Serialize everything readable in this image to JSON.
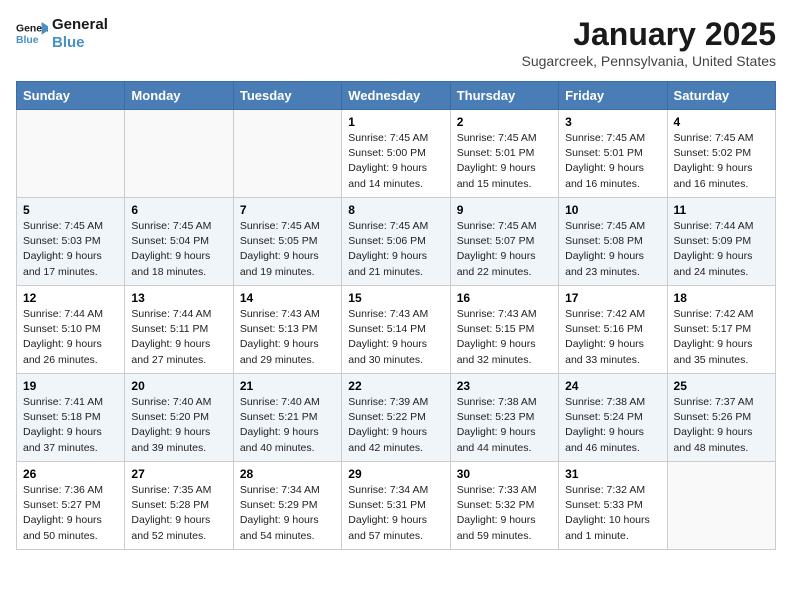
{
  "header": {
    "logo_line1": "General",
    "logo_line2": "Blue",
    "month_title": "January 2025",
    "subtitle": "Sugarcreek, Pennsylvania, United States"
  },
  "weekdays": [
    "Sunday",
    "Monday",
    "Tuesday",
    "Wednesday",
    "Thursday",
    "Friday",
    "Saturday"
  ],
  "weeks": [
    [
      {
        "day": "",
        "info": ""
      },
      {
        "day": "",
        "info": ""
      },
      {
        "day": "",
        "info": ""
      },
      {
        "day": "1",
        "info": "Sunrise: 7:45 AM\nSunset: 5:00 PM\nDaylight: 9 hours\nand 14 minutes."
      },
      {
        "day": "2",
        "info": "Sunrise: 7:45 AM\nSunset: 5:01 PM\nDaylight: 9 hours\nand 15 minutes."
      },
      {
        "day": "3",
        "info": "Sunrise: 7:45 AM\nSunset: 5:01 PM\nDaylight: 9 hours\nand 16 minutes."
      },
      {
        "day": "4",
        "info": "Sunrise: 7:45 AM\nSunset: 5:02 PM\nDaylight: 9 hours\nand 16 minutes."
      }
    ],
    [
      {
        "day": "5",
        "info": "Sunrise: 7:45 AM\nSunset: 5:03 PM\nDaylight: 9 hours\nand 17 minutes."
      },
      {
        "day": "6",
        "info": "Sunrise: 7:45 AM\nSunset: 5:04 PM\nDaylight: 9 hours\nand 18 minutes."
      },
      {
        "day": "7",
        "info": "Sunrise: 7:45 AM\nSunset: 5:05 PM\nDaylight: 9 hours\nand 19 minutes."
      },
      {
        "day": "8",
        "info": "Sunrise: 7:45 AM\nSunset: 5:06 PM\nDaylight: 9 hours\nand 21 minutes."
      },
      {
        "day": "9",
        "info": "Sunrise: 7:45 AM\nSunset: 5:07 PM\nDaylight: 9 hours\nand 22 minutes."
      },
      {
        "day": "10",
        "info": "Sunrise: 7:45 AM\nSunset: 5:08 PM\nDaylight: 9 hours\nand 23 minutes."
      },
      {
        "day": "11",
        "info": "Sunrise: 7:44 AM\nSunset: 5:09 PM\nDaylight: 9 hours\nand 24 minutes."
      }
    ],
    [
      {
        "day": "12",
        "info": "Sunrise: 7:44 AM\nSunset: 5:10 PM\nDaylight: 9 hours\nand 26 minutes."
      },
      {
        "day": "13",
        "info": "Sunrise: 7:44 AM\nSunset: 5:11 PM\nDaylight: 9 hours\nand 27 minutes."
      },
      {
        "day": "14",
        "info": "Sunrise: 7:43 AM\nSunset: 5:13 PM\nDaylight: 9 hours\nand 29 minutes."
      },
      {
        "day": "15",
        "info": "Sunrise: 7:43 AM\nSunset: 5:14 PM\nDaylight: 9 hours\nand 30 minutes."
      },
      {
        "day": "16",
        "info": "Sunrise: 7:43 AM\nSunset: 5:15 PM\nDaylight: 9 hours\nand 32 minutes."
      },
      {
        "day": "17",
        "info": "Sunrise: 7:42 AM\nSunset: 5:16 PM\nDaylight: 9 hours\nand 33 minutes."
      },
      {
        "day": "18",
        "info": "Sunrise: 7:42 AM\nSunset: 5:17 PM\nDaylight: 9 hours\nand 35 minutes."
      }
    ],
    [
      {
        "day": "19",
        "info": "Sunrise: 7:41 AM\nSunset: 5:18 PM\nDaylight: 9 hours\nand 37 minutes."
      },
      {
        "day": "20",
        "info": "Sunrise: 7:40 AM\nSunset: 5:20 PM\nDaylight: 9 hours\nand 39 minutes."
      },
      {
        "day": "21",
        "info": "Sunrise: 7:40 AM\nSunset: 5:21 PM\nDaylight: 9 hours\nand 40 minutes."
      },
      {
        "day": "22",
        "info": "Sunrise: 7:39 AM\nSunset: 5:22 PM\nDaylight: 9 hours\nand 42 minutes."
      },
      {
        "day": "23",
        "info": "Sunrise: 7:38 AM\nSunset: 5:23 PM\nDaylight: 9 hours\nand 44 minutes."
      },
      {
        "day": "24",
        "info": "Sunrise: 7:38 AM\nSunset: 5:24 PM\nDaylight: 9 hours\nand 46 minutes."
      },
      {
        "day": "25",
        "info": "Sunrise: 7:37 AM\nSunset: 5:26 PM\nDaylight: 9 hours\nand 48 minutes."
      }
    ],
    [
      {
        "day": "26",
        "info": "Sunrise: 7:36 AM\nSunset: 5:27 PM\nDaylight: 9 hours\nand 50 minutes."
      },
      {
        "day": "27",
        "info": "Sunrise: 7:35 AM\nSunset: 5:28 PM\nDaylight: 9 hours\nand 52 minutes."
      },
      {
        "day": "28",
        "info": "Sunrise: 7:34 AM\nSunset: 5:29 PM\nDaylight: 9 hours\nand 54 minutes."
      },
      {
        "day": "29",
        "info": "Sunrise: 7:34 AM\nSunset: 5:31 PM\nDaylight: 9 hours\nand 57 minutes."
      },
      {
        "day": "30",
        "info": "Sunrise: 7:33 AM\nSunset: 5:32 PM\nDaylight: 9 hours\nand 59 minutes."
      },
      {
        "day": "31",
        "info": "Sunrise: 7:32 AM\nSunset: 5:33 PM\nDaylight: 10 hours\nand 1 minute."
      },
      {
        "day": "",
        "info": ""
      }
    ]
  ]
}
